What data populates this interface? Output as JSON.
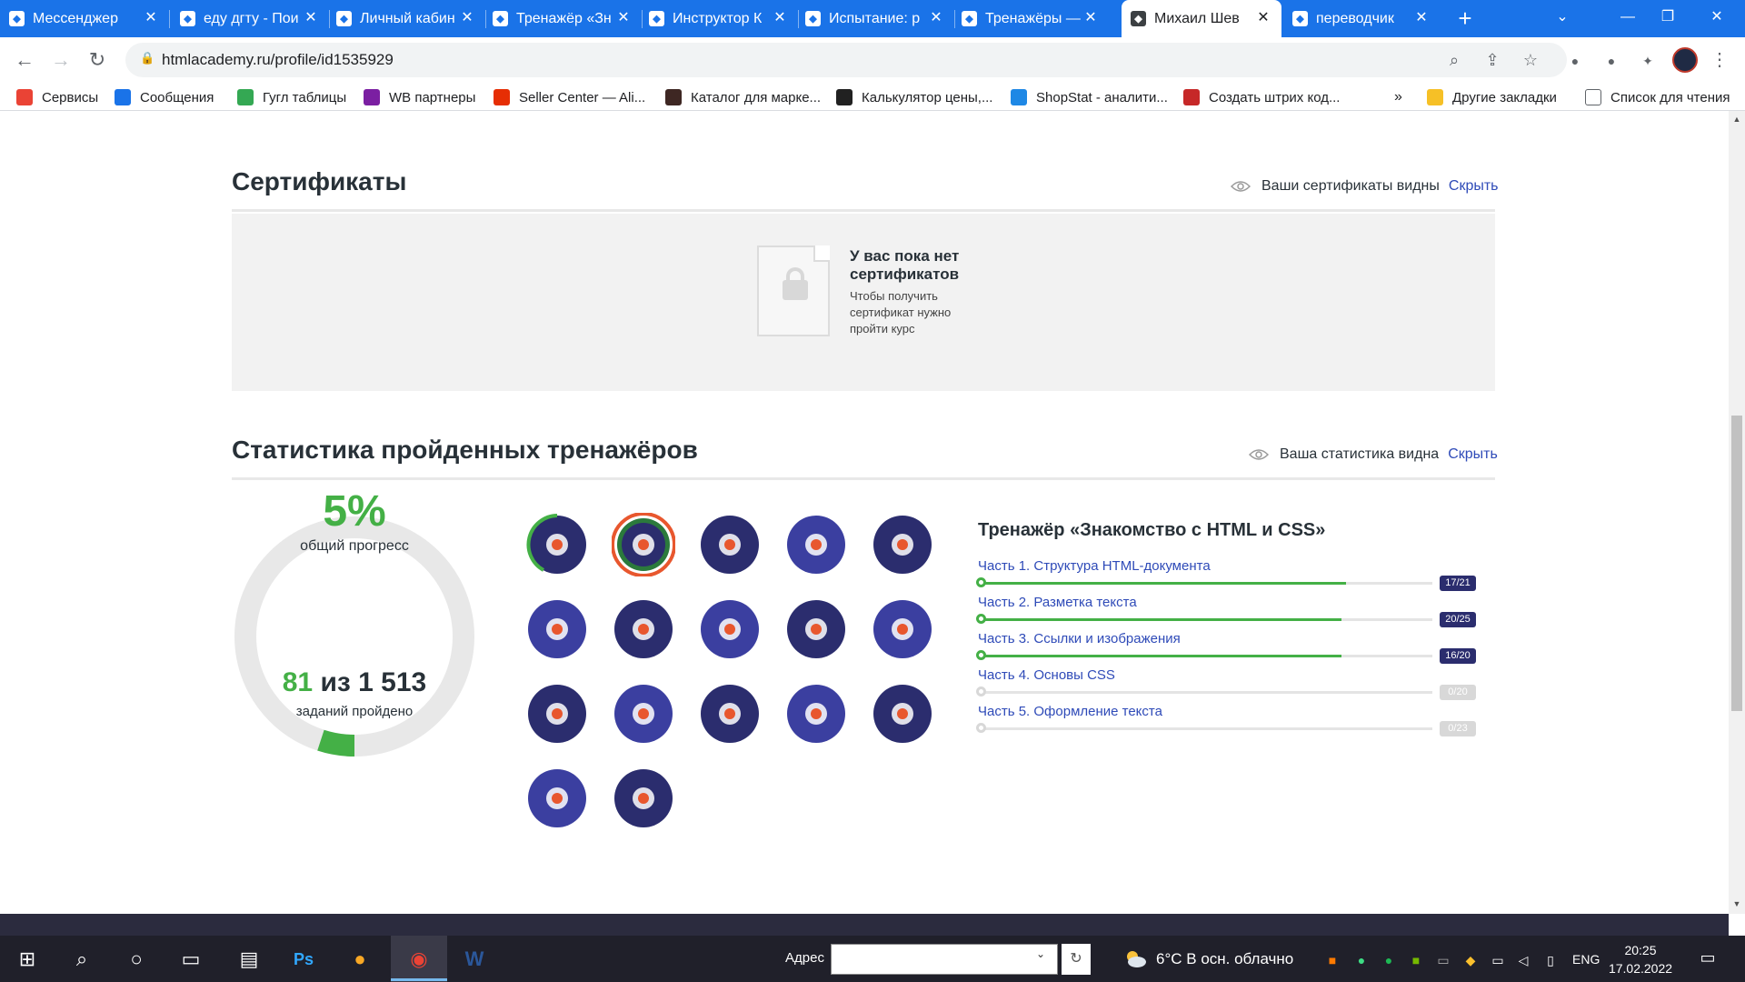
{
  "browser": {
    "tabs": [
      {
        "label": "Мессенджер",
        "icon": "messenger-icon",
        "active": false
      },
      {
        "label": "еду дгту - Пои",
        "icon": "google-icon",
        "active": false
      },
      {
        "label": "Личный кабин",
        "icon": "cabinet-icon",
        "active": false
      },
      {
        "label": "Тренажёр «Зн",
        "icon": "htmlacademy-icon",
        "active": false
      },
      {
        "label": "Инструктор К",
        "icon": "google-icon",
        "active": false
      },
      {
        "label": "Испытание: р",
        "icon": "htmlacademy-icon",
        "active": false
      },
      {
        "label": "Тренажёры —",
        "icon": "htmlacademy-icon",
        "active": false
      },
      {
        "label": "Михаил Шев",
        "icon": "htmlacademy-icon",
        "active": true
      },
      {
        "label": "переводчик",
        "icon": "google-icon",
        "active": false
      }
    ],
    "url": "htmlacademy.ru/profile/id1535929",
    "bookmarks": [
      {
        "label": "Сервисы",
        "icon": "apps-grid-icon",
        "color": "#ea4335"
      },
      {
        "label": "Сообщения",
        "icon": "messages-icon",
        "color": "#1a73e8"
      },
      {
        "label": "Гугл таблицы",
        "icon": "drive-icon",
        "color": "#34a853"
      },
      {
        "label": "WB партнеры",
        "icon": "wb-icon",
        "color": "#7b1fa2"
      },
      {
        "label": "Seller Center — Ali...",
        "icon": "aliexpress-icon",
        "color": "#e62e04"
      },
      {
        "label": "Каталог для марке...",
        "icon": "catalog-icon",
        "color": "#3e2723"
      },
      {
        "label": "Калькулятор цены,...",
        "icon": "calculator-icon",
        "color": "#212121"
      },
      {
        "label": "ShopStat - аналити...",
        "icon": "shopstat-icon",
        "color": "#1e88e5"
      },
      {
        "label": "Создать штрих код...",
        "icon": "barcode-icon",
        "color": "#c62828"
      }
    ],
    "bookmarks_more": "»",
    "other_bookmarks": "Другие закладки",
    "reading_list": "Список для чтения"
  },
  "certificates": {
    "title": "Сертификаты",
    "visibility_text": "Ваши сертификаты видны",
    "hide_link": "Скрыть",
    "empty_title": "У вас пока нет сертификатов",
    "empty_desc": "Чтобы получить сертификат нужно пройти курс"
  },
  "stats": {
    "title": "Статистика пройденных тренажёров",
    "visibility_text": "Ваша статистика видна",
    "hide_link": "Скрыть",
    "progress_percent": "5%",
    "progress_value": 0.05,
    "progress_label": "общий прогресс",
    "tasks_done": "81",
    "tasks_sep": " из ",
    "tasks_total": "1 513",
    "tasks_label": "заданий пройдено",
    "accent_color": "#44b046",
    "badges": [
      "traffic-light-icon",
      "hand-badge-icon",
      "spinning-top-icon",
      "php-barrier-icon",
      "robot-head-icon",
      "curly-braces-icon",
      "fox-cat-icon",
      "football-field-icon",
      "paintbrush-icon",
      "anvil-icon",
      "fox-cocktail-icon",
      "circle-nodes-icon",
      "grid-cube-icon",
      "remote-control-icon",
      "globe-icon",
      "chainsaw-icon",
      "typography-t-icon"
    ],
    "trainer": {
      "title": "Тренажёр «Знакомство с HTML и CSS»",
      "parts": [
        {
          "label": "Часть 1. Структура HTML-документа",
          "count": "17/21",
          "progress": 0.81
        },
        {
          "label": "Часть 2. Разметка текста",
          "count": "20/25",
          "progress": 0.8
        },
        {
          "label": "Часть 3. Ссылки и изображения",
          "count": "16/20",
          "progress": 0.8
        },
        {
          "label": "Часть 4. Основы CSS",
          "count": "0/20",
          "progress": 0
        },
        {
          "label": "Часть 5. Оформление текста",
          "count": "0/23",
          "progress": 0
        }
      ]
    }
  },
  "taskbar": {
    "address_label": "Адрес",
    "weather": "6°C  В осн. облачно",
    "lang": "ENG",
    "time": "20:25",
    "date": "17.02.2022"
  }
}
